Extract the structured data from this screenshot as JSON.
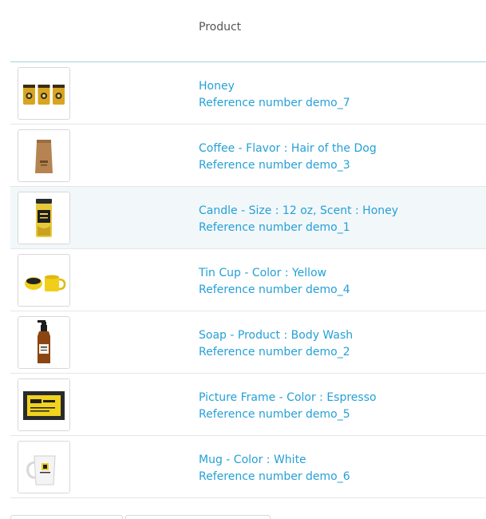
{
  "table": {
    "header": {
      "product_label": "Product"
    },
    "rows": [
      {
        "name": "Honey",
        "reference": "Reference number demo_7",
        "image_icon": "honey-jars-icon"
      },
      {
        "name": "Coffee - Flavor : Hair of the Dog",
        "reference": "Reference number demo_3",
        "image_icon": "coffee-bag-icon"
      },
      {
        "name": "Candle - Size : 12 oz, Scent : Honey",
        "reference": "Reference number demo_1",
        "image_icon": "candle-jar-icon"
      },
      {
        "name": "Tin Cup - Color : Yellow",
        "reference": "Reference number demo_4",
        "image_icon": "tin-cup-icon"
      },
      {
        "name": "Soap - Product : Body Wash",
        "reference": "Reference number demo_2",
        "image_icon": "soap-bottle-icon"
      },
      {
        "name": "Picture Frame - Color : Espresso",
        "reference": "Reference number demo_5",
        "image_icon": "picture-frame-icon"
      },
      {
        "name": "Mug - Color : White",
        "reference": "Reference number demo_6",
        "image_icon": "mug-icon"
      }
    ]
  },
  "colors": {
    "link": "#25a0d6",
    "header_border": "#a9cfe0",
    "row_highlight": "#f2f7fa",
    "header_text": "#555555"
  }
}
